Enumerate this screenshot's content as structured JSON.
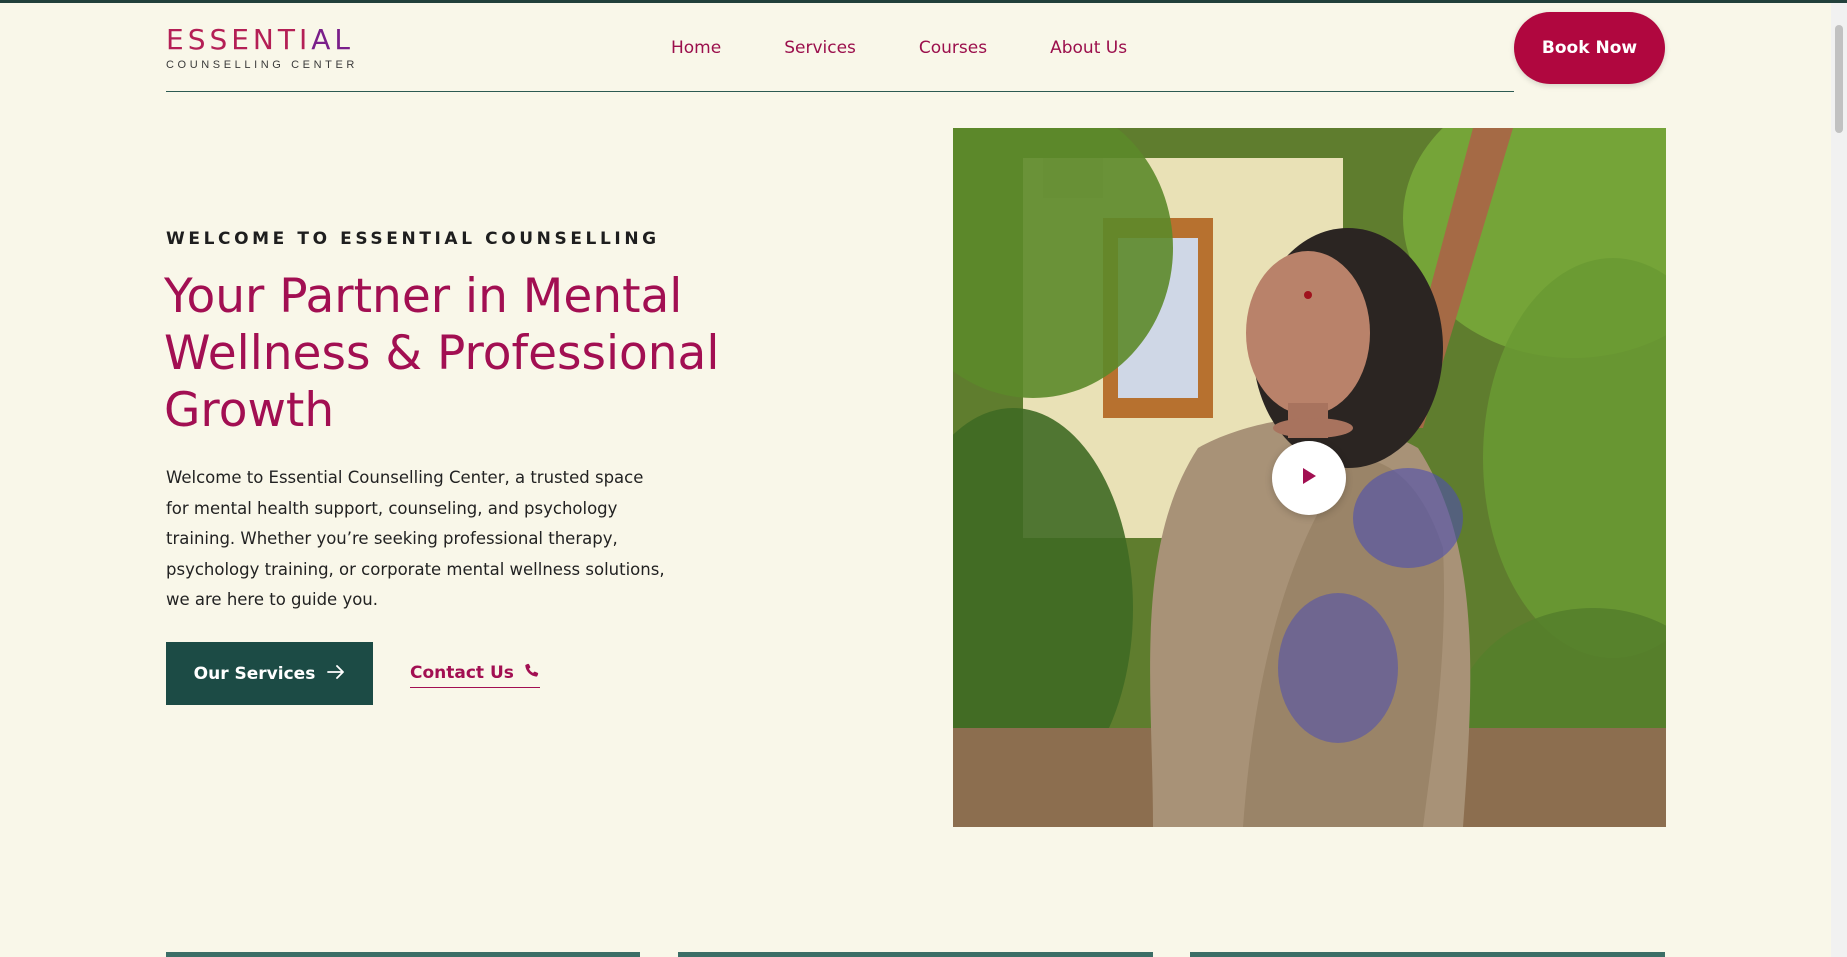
{
  "brand": {
    "name_main": "ESSENTI",
    "name_tail": "AL",
    "subtitle": "COUNSELLING CENTER"
  },
  "nav": {
    "items": [
      {
        "label": "Home"
      },
      {
        "label": "Services"
      },
      {
        "label": "Courses"
      },
      {
        "label": "About Us"
      }
    ]
  },
  "header": {
    "book_label": "Book Now"
  },
  "hero": {
    "eyebrow": "WELCOME TO ESSENTIAL COUNSELLING",
    "headline_line1": "Your Partner in Mental",
    "headline_line2": "Wellness & Professional",
    "headline_line3": "Growth",
    "intro_line1": "Welcome to Essential Counselling Center, a trusted space",
    "intro_line2": "for mental health support, counseling, and psychology",
    "intro_line3": "training. Whether you’re seeking professional therapy,",
    "intro_line4": "psychology training, or corporate mental wellness solutions,",
    "intro_line5": "we are here to guide you.",
    "primary_cta": "Our Services",
    "secondary_cta": "Contact Us",
    "icons": {
      "primary_cta": "arrow-right-icon",
      "secondary_cta": "phone-icon",
      "video": "play-icon"
    }
  },
  "colors": {
    "background": "#f9f7e9",
    "brand_magenta": "#a20f52",
    "button_red": "#b0073f",
    "dark_teal": "#1c4b45"
  }
}
